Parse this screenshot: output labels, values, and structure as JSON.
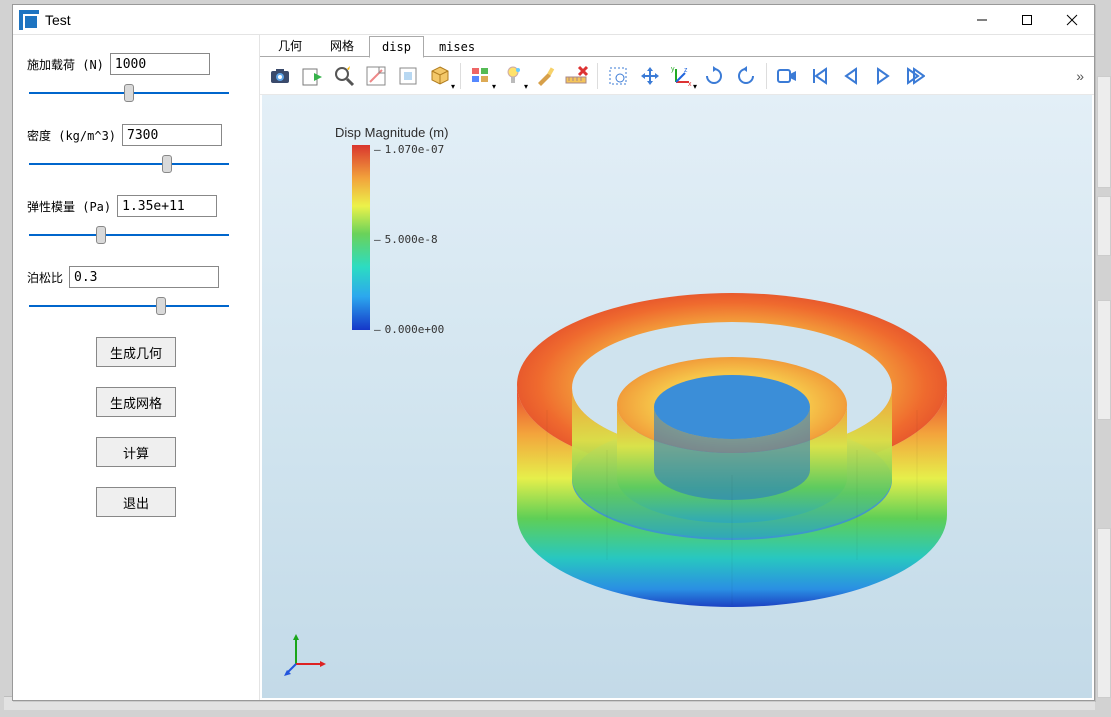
{
  "window": {
    "title": "Test"
  },
  "params": {
    "load": {
      "label": "施加载荷 (N)",
      "value": "1000"
    },
    "density": {
      "label": "密度 (kg/m^3)",
      "value": "7300"
    },
    "youngs": {
      "label": "弹性模量 (Pa)",
      "value": "1.35e+11"
    },
    "poisson": {
      "label": "泊松比",
      "value": "0.3"
    }
  },
  "buttons": {
    "gen_geom": "生成几何",
    "gen_mesh": "生成网格",
    "solve": "计算",
    "exit": "退出"
  },
  "tabs": {
    "geometry": "几何",
    "mesh": "网格",
    "disp": "disp",
    "mises": "mises",
    "active": "disp"
  },
  "legend": {
    "title": "Disp Magnitude (m)",
    "max": "1.070e-07",
    "mid": "5.000e-8",
    "min": "0.000e+00"
  },
  "toolbar": {
    "items": [
      "screenshot-icon",
      "save-scene-icon",
      "zoom-icon",
      "zoom-box-icon",
      "fit-reset-icon",
      "iso-box-icon",
      "sep",
      "multi-view-icon",
      "light-icon",
      "brush-icon",
      "ruler-delete-icon",
      "sep",
      "select-rect-icon",
      "move-icon",
      "axes-icon",
      "rotate-cw-icon",
      "rotate-ccw-icon",
      "sep",
      "record-icon",
      "step-first-icon",
      "step-back-icon",
      "step-forward-icon",
      "step-last-icon"
    ]
  }
}
